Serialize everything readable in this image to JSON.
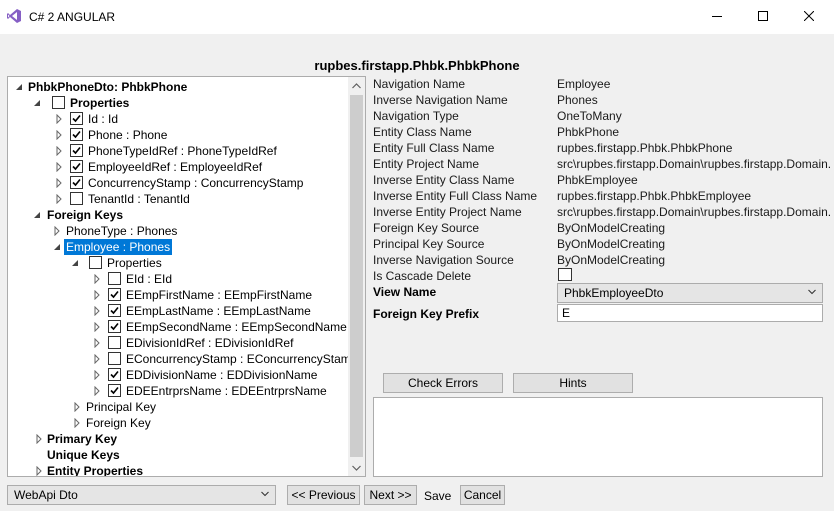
{
  "window": {
    "title": "C# 2 ANGULAR"
  },
  "header": {
    "title": "rupbes.firstapp.Phbk.PhbkPhone"
  },
  "tree": {
    "root": "PhbkPhoneDto: PhbkPhone",
    "properties": "Properties",
    "prop_items": [
      "Id : Id",
      "Phone : Phone",
      "PhoneTypeIdRef : PhoneTypeIdRef",
      "EmployeeIdRef : EmployeeIdRef",
      "ConcurrencyStamp : ConcurrencyStamp",
      "TenantId : TenantId"
    ],
    "foreign_keys": "Foreign Keys",
    "fk_phonetype": "PhoneType : Phones",
    "fk_employee": "Employee : Phones",
    "fk_properties": "Properties",
    "fk_items": [
      "EId : EId",
      "EEmpFirstName : EEmpFirstName",
      "EEmpLastName : EEmpLastName",
      "EEmpSecondName : EEmpSecondName",
      "EDivisionIdRef : EDivisionIdRef",
      "EConcurrencyStamp : EConcurrencyStamp",
      "EDDivisionName : EDDivisionName",
      "EDEEntrprsName : EDEEntrprsName"
    ],
    "principal_key": "Principal Key",
    "foreign_key": "Foreign Key",
    "primary_key": "Primary Key",
    "unique_keys": "Unique Keys",
    "entity_properties": "Entity Properties"
  },
  "details": {
    "labels": [
      "Navigation Name",
      "Inverse Navigation Name",
      "Navigation Type",
      "Entity Class Name",
      "Entity Full Class Name",
      "Entity Project Name",
      "Inverse Entity Class Name",
      "Inverse Entity Full Class Name",
      "Inverse Entity Project Name",
      "Foreign Key Source",
      "Principal Key Source",
      "Inverse Navigation Source",
      "Is Cascade Delete"
    ],
    "values": [
      "Employee",
      "Phones",
      "OneToMany",
      "PhbkPhone",
      "rupbes.firstapp.Phbk.PhbkPhone",
      "src\\rupbes.firstapp.Domain\\rupbes.firstapp.Domain.",
      "PhbkEmployee",
      "rupbes.firstapp.Phbk.PhbkEmployee",
      "src\\rupbes.firstapp.Domain\\rupbes.firstapp.Domain.",
      "ByOnModelCreating",
      "ByOnModelCreating",
      "ByOnModelCreating"
    ],
    "view_name_label": "View Name",
    "view_name_value": "PhbkEmployeeDto",
    "fk_prefix_label": "Foreign Key Prefix",
    "fk_prefix_value": "E"
  },
  "buttons": {
    "check_errors": "Check Errors",
    "hints": "Hints",
    "previous": "<< Previous",
    "next": "Next >>",
    "save": "Save",
    "cancel": "Cancel"
  },
  "bottom": {
    "dto_select": "WebApi Dto"
  },
  "colors": {
    "selection": "#0078d7",
    "icon_purple": "#865fc5"
  }
}
